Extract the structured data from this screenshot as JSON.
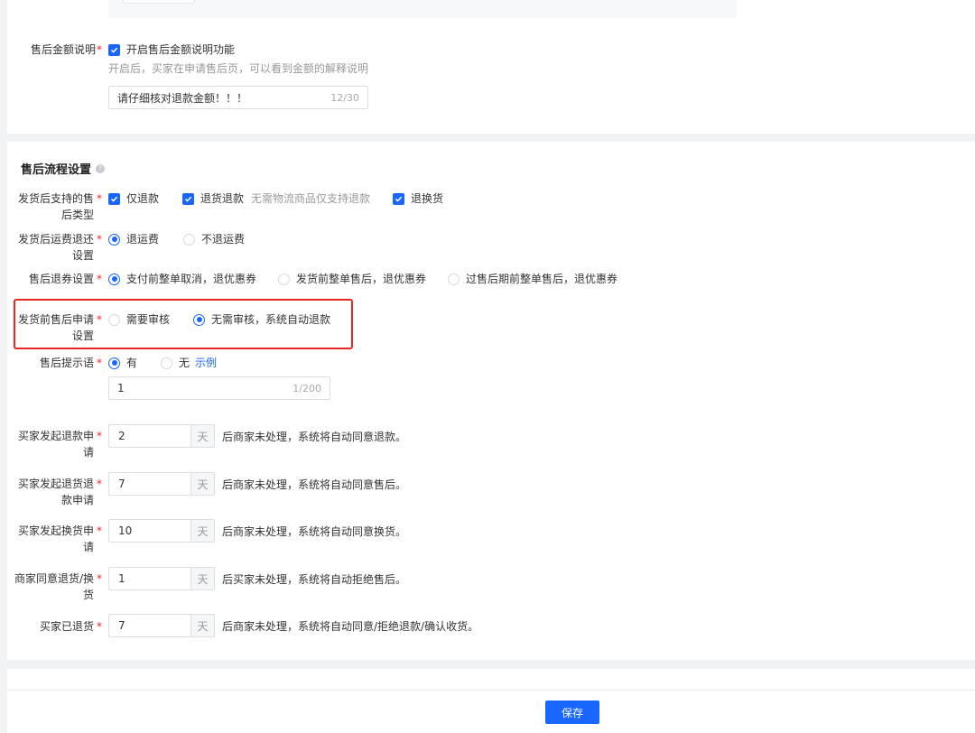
{
  "amount_desc": {
    "label": "售后金额说明",
    "checkbox_label": "开启售后金额说明功能",
    "hint": "开启后，买家在申请售后页，可以看到金额的解释说明",
    "input_value": "请仔细核对退款金额！！！",
    "input_count": "12/30"
  },
  "flow": {
    "title": "售后流程设置",
    "types": {
      "label": "发货后支持的售后类型",
      "options": [
        "仅退款",
        "退货退款",
        "退换货"
      ],
      "hint": "无需物流商品仅支持退款"
    },
    "freight": {
      "label": "发货后运费退还设置",
      "options": [
        "退运费",
        "不退运费"
      ],
      "selected": 0
    },
    "coupon": {
      "label": "售后退券设置",
      "options": [
        "支付前整单取消，退优惠券",
        "发货前整单售后，退优惠券",
        "过售后期前整单售后，退优惠券"
      ],
      "selected": 0
    },
    "pre_ship": {
      "label": "发货前售后申请设置",
      "options": [
        "需要审核",
        "无需审核，系统自动退款"
      ],
      "selected": 1
    },
    "tip": {
      "label": "售后提示语",
      "options": [
        "有",
        "无"
      ],
      "selected": 0,
      "example_link": "示例",
      "input_value": "1",
      "input_count": "1/200"
    },
    "timeouts": [
      {
        "label": "买家发起退款申请",
        "value": "2",
        "unit": "天",
        "after": "后商家未处理，系统将自动同意退款。"
      },
      {
        "label": "买家发起退货退款申请",
        "value": "7",
        "unit": "天",
        "after": "后商家未处理，系统将自动同意售后。"
      },
      {
        "label": "买家发起换货申请",
        "value": "10",
        "unit": "天",
        "after": "后商家未处理，系统将自动同意换货。"
      },
      {
        "label": "商家同意退货/换货",
        "value": "1",
        "unit": "天",
        "after": "后买家未处理，系统将自动拒绝售后。"
      },
      {
        "label": "买家已退货",
        "value": "7",
        "unit": "天",
        "after": "后商家未处理，系统将自动同意/拒绝退款/确认收货。"
      }
    ]
  },
  "footer": {
    "save_label": "保存"
  },
  "colors": {
    "primary": "#1966ff",
    "required": "#f5222d",
    "highlight_border": "#e8251f"
  }
}
